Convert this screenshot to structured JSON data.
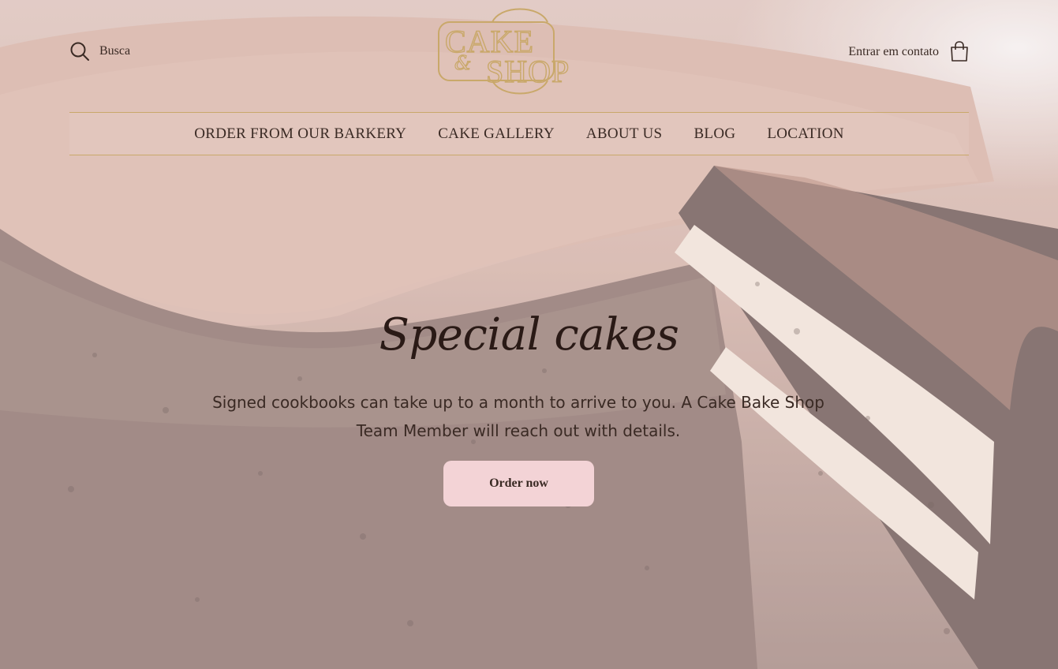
{
  "header": {
    "search_label": "Busca",
    "logo_text_top": "CAKE",
    "logo_text_bottom": "SHOP",
    "contact_label": "Entrar em contato"
  },
  "nav": {
    "items": [
      {
        "label": "ORDER FROM OUR BARKERY"
      },
      {
        "label": "CAKE GALLERY"
      },
      {
        "label": "ABOUT US"
      },
      {
        "label": "BLOG"
      },
      {
        "label": "LOCATION"
      }
    ]
  },
  "hero": {
    "title": "Special cakes",
    "text": "Signed cookbooks can take up to a month to arrive to you. A Cake Bake Shop Team Member will reach out with details.",
    "button_label": "Order now"
  },
  "colors": {
    "accent_gold": "#c9a86a",
    "button_pink": "#f3d3d6",
    "text_dark": "#3a2a24"
  },
  "icons": {
    "search": "search-icon",
    "cart": "shopping-bag-icon"
  }
}
